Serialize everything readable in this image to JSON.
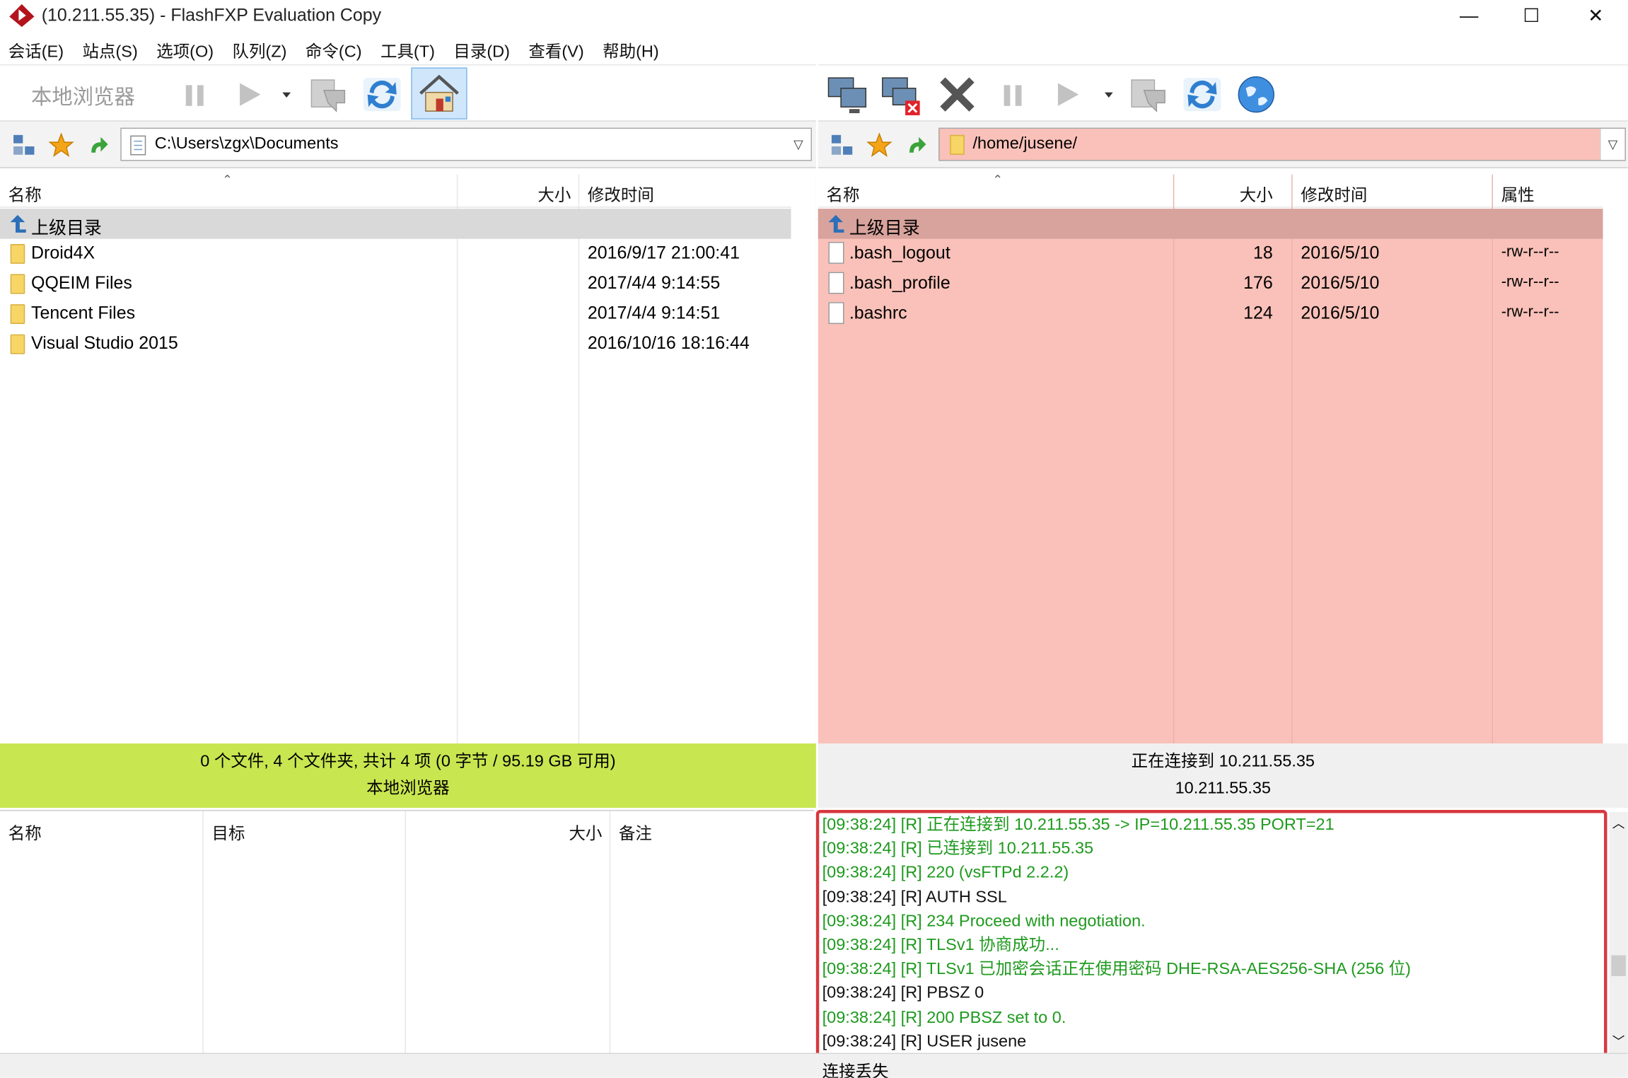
{
  "window": {
    "title": "(10.211.55.35) - FlashFXP Evaluation Copy",
    "minimize": "—",
    "maximize": "☐",
    "close": "✕"
  },
  "menu": [
    "会话(E)",
    "站点(S)",
    "选项(O)",
    "队列(Z)",
    "命令(C)",
    "工具(T)",
    "目录(D)",
    "查看(V)",
    "帮助(H)"
  ],
  "local": {
    "toolbar_label": "本地浏览器",
    "path": "C:\\Users\\zgx\\Documents",
    "columns": {
      "name": "名称",
      "size": "大小",
      "modified": "修改时间"
    },
    "up_label": "上级目录",
    "rows": [
      {
        "name": "Droid4X",
        "size": "",
        "modified": "2016/9/17 21:00:41"
      },
      {
        "name": "QQEIM Files",
        "size": "",
        "modified": "2017/4/4 9:14:55"
      },
      {
        "name": "Tencent Files",
        "size": "",
        "modified": "2017/4/4 9:14:51"
      },
      {
        "name": "Visual Studio 2015",
        "size": "",
        "modified": "2016/10/16 18:16:44"
      }
    ],
    "status_line1": "0 个文件, 4 个文件夹, 共计 4 项 (0 字节 / 95.19 GB 可用)",
    "status_line2": "本地浏览器"
  },
  "remote": {
    "path": "/home/jusene/",
    "columns": {
      "name": "名称",
      "size": "大小",
      "modified": "修改时间",
      "attrs": "属性"
    },
    "up_label": "上级目录",
    "rows": [
      {
        "name": ".bash_logout",
        "size": "18",
        "modified": "2016/5/10",
        "attrs": "-rw-r--r--"
      },
      {
        "name": ".bash_profile",
        "size": "176",
        "modified": "2016/5/10",
        "attrs": "-rw-r--r--"
      },
      {
        "name": ".bashrc",
        "size": "124",
        "modified": "2016/5/10",
        "attrs": "-rw-r--r--"
      }
    ],
    "status_line1": "正在连接到 10.211.55.35",
    "status_line2": "10.211.55.35"
  },
  "queue": {
    "columns": {
      "name": "名称",
      "target": "目标",
      "size": "大小",
      "note": "备注"
    }
  },
  "log": [
    {
      "text": "[09:38:24]  [R] 正在连接到 10.211.55.35 -> IP=10.211.55.35 PORT=21",
      "kind": "green"
    },
    {
      "text": "[09:38:24]  [R] 已连接到 10.211.55.35",
      "kind": "green"
    },
    {
      "text": "[09:38:24]  [R] 220 (vsFTPd 2.2.2)",
      "kind": "green"
    },
    {
      "text": "[09:38:24]  [R] AUTH SSL",
      "kind": "black"
    },
    {
      "text": "[09:38:24]  [R] 234 Proceed with negotiation.",
      "kind": "green"
    },
    {
      "text": "[09:38:24]  [R] TLSv1 协商成功...",
      "kind": "green"
    },
    {
      "text": "[09:38:24]  [R] TLSv1 已加密会话正在使用密码 DHE-RSA-AES256-SHA (256 位)",
      "kind": "green"
    },
    {
      "text": "[09:38:24]  [R] PBSZ 0",
      "kind": "black"
    },
    {
      "text": "[09:38:24]  [R] 200 PBSZ set to 0.",
      "kind": "green"
    },
    {
      "text": "[09:38:24]  [R] USER jusene",
      "kind": "black"
    }
  ],
  "bottom_status": "连接丢失",
  "colors": {
    "remote_bg": "#f9c1b9",
    "remote_up_row": "#d8a39c",
    "local_status_bg": "#c8e650",
    "log_green": "#1e9a1e",
    "log_border": "#d7373f"
  }
}
